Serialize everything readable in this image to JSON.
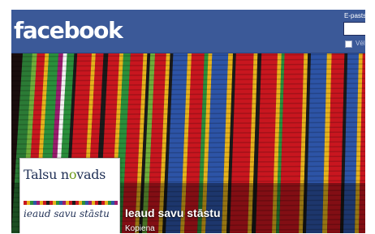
{
  "header": {
    "logo": "facebook",
    "email_label": "E-pasts",
    "keep_logged_in_label": "Vēl"
  },
  "page": {
    "name": "Ieaud savu stāstu",
    "category": "Kopiena"
  },
  "profile_picture": {
    "title_before": "Talsu n",
    "title_o": "o",
    "title_after": "vads",
    "subtitle": "ieaud savu stāstu"
  },
  "colors": {
    "header_blue": "#3b5998",
    "stripe_red": "#c8161f",
    "stripe_green": "#2a8f3b",
    "stripe_blue": "#2d54a6",
    "stripe_yellow": "#e6b21c"
  },
  "icons": {
    "logo": "facebook-logo",
    "keep_logged_in": "checkbox"
  }
}
